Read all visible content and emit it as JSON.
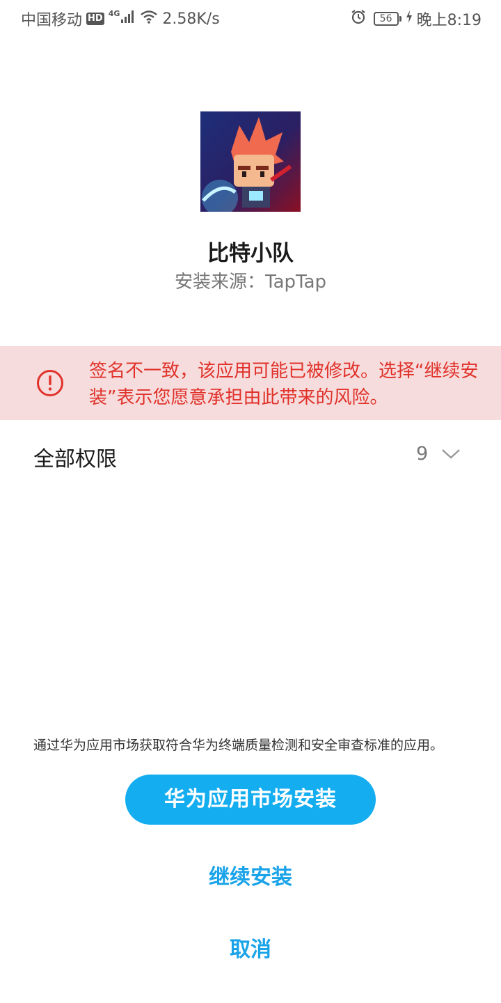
{
  "status_bar": {
    "carrier": "中国移动",
    "hd_badge": "HD",
    "network_gen": "4G",
    "speed": "2.58K/s",
    "battery_level": "56",
    "time": "晚上8:19",
    "icons": [
      "signal-icon",
      "wifi-icon",
      "alarm-icon",
      "battery-icon",
      "charging-icon"
    ]
  },
  "app": {
    "name": "比特小队",
    "source": "安装来源：TapTap",
    "icon": "app-icon"
  },
  "warning": {
    "icon": "exclamation-circle-icon",
    "text": "签名不一致，该应用可能已被修改。选择“继续安装”表示您愿意承担由此带来的风险。",
    "color": "#e0322b",
    "background": "#f6dcdc"
  },
  "permissions": {
    "label": "全部权限",
    "count": "9",
    "expand_icon": "chevron-down-icon"
  },
  "footer": {
    "note": "通过华为应用市场获取符合华为终端质量检测和安全审查标准的应用。",
    "primary_button": "华为应用市场安装",
    "continue_button": "继续安装",
    "cancel_button": "取消",
    "accent_color": "#14adf0"
  }
}
